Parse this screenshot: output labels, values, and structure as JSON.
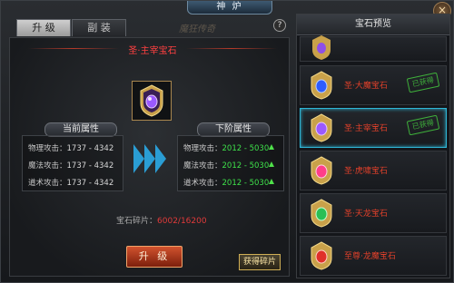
{
  "window": {
    "title": "神 炉",
    "close": "×",
    "help": "?",
    "watermark": "魔狂传奇"
  },
  "tabs": [
    {
      "label": "升 级"
    },
    {
      "label": "副 装"
    }
  ],
  "main": {
    "gem_title": "圣·主宰宝石",
    "current_header": "当前属性",
    "next_header": "下阶属性",
    "current_attrs": [
      {
        "label": "物理攻击：",
        "value": "1737 - 4342"
      },
      {
        "label": "魔法攻击：",
        "value": "1737 - 4342"
      },
      {
        "label": "道术攻击：",
        "value": "1737 - 4342"
      }
    ],
    "next_attrs": [
      {
        "label": "物理攻击：",
        "value": "2012 - 5030"
      },
      {
        "label": "魔法攻击：",
        "value": "2012 - 5030"
      },
      {
        "label": "道术攻击：",
        "value": "2012 - 5030"
      }
    ],
    "shards_label": "宝石碎片：",
    "shards_value": "6002/16200",
    "upgrade_label": "升 级",
    "get_label": "获得碎片"
  },
  "preview": {
    "title": "宝石预览",
    "items": [
      {
        "name": "",
        "stamp": "",
        "icon": "gem-crest-purple"
      },
      {
        "name": "圣·大魔宝石",
        "stamp": "已获得",
        "icon": "gem-crest-blue"
      },
      {
        "name": "圣·主宰宝石",
        "stamp": "已获得",
        "icon": "gem-crest-purple"
      },
      {
        "name": "圣·虎啸宝石",
        "stamp": "",
        "icon": "gem-crest-pink"
      },
      {
        "name": "圣·天龙宝石",
        "stamp": "",
        "icon": "gem-crest-green"
      },
      {
        "name": "至尊·龙魔宝石",
        "stamp": "",
        "icon": "gem-crest-red"
      }
    ]
  },
  "colors": {
    "accent_red": "#e0402a",
    "accent_green": "#3ee04a",
    "highlight_blue": "#2fb6d6"
  }
}
